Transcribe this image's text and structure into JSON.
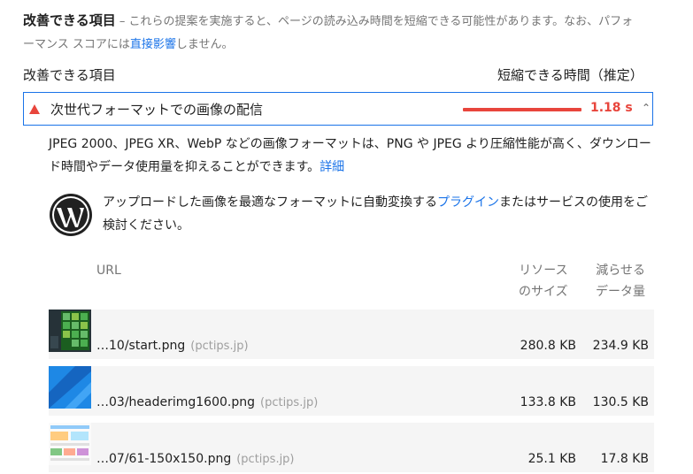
{
  "header": {
    "title": "改善できる項目",
    "dash": " – ",
    "description_before_link": "これらの提案を実施すると、ページの読み込み時間を短縮できる可能性があります。なお、パフォーマンス スコアには",
    "description_link": "直接影響",
    "description_after_link": "しません。"
  },
  "columns": {
    "left": "改善できる項目",
    "right": "短縮できる時間（推定）"
  },
  "audit": {
    "title": "次世代フォーマットでの画像の配信",
    "savings": "1.18 s",
    "savings_color": "#e8453c",
    "chevron": "^",
    "description_text": "JPEG 2000、JPEG XR、WebP などの画像フォーマットは、PNG や JPEG より圧縮性能が高く、ダウンロード時間やデータ使用量を抑えることができます。",
    "description_link": "詳細",
    "wp_text_before": "アップロードした画像を最適なフォーマットに自動変換する",
    "wp_link": "プラグイン",
    "wp_text_after": "またはサービスの使用をご検討ください。"
  },
  "table": {
    "col_url": "URL",
    "col_size_line1": "リソース",
    "col_size_line2": "のサイズ",
    "col_savings_line1": "減らせる",
    "col_savings_line2": "データ量",
    "rows": [
      {
        "file": "…10/start.png",
        "domain": "(pctips.jp)",
        "size": "280.8 KB",
        "savings": "234.9 KB"
      },
      {
        "file": "…03/headerimg1600.png",
        "domain": "(pctips.jp)",
        "size": "133.8 KB",
        "savings": "130.5 KB"
      },
      {
        "file": "…07/61-150x150.png",
        "domain": "(pctips.jp)",
        "size": "25.1 KB",
        "savings": "17.8 KB"
      }
    ]
  },
  "colors": {
    "link": "#1a73e8",
    "fail": "#e8453c",
    "row_bg": "#f5f5f5"
  }
}
